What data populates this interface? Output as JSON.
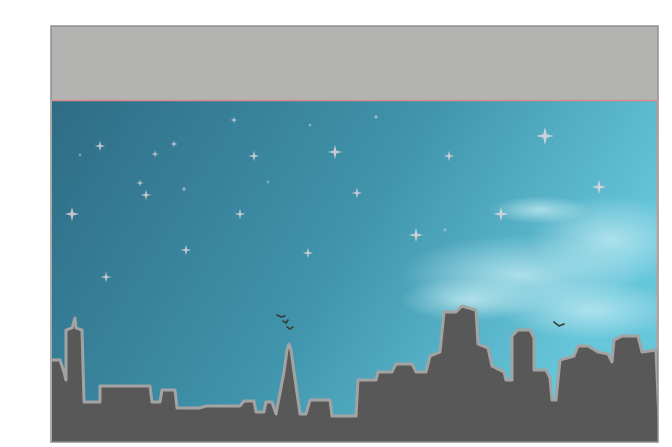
{
  "colors": {
    "page_bg": "#ffffff",
    "header_bar": "#b3b3b1",
    "frame_border": "#8e8e8e",
    "divider_line": "#d98b8b",
    "sky_top_left": "#2f6c85",
    "sky_mid": "#3f93ab",
    "sky_right": "#66c6da",
    "cloud": "#c6ecf3",
    "skyline_fill": "#585858",
    "skyline_outline": "#a3a3a3",
    "star": "#e9d9df",
    "bird": "#3a3a3a"
  },
  "scene": {
    "elements": [
      "header-bar",
      "night-sky",
      "stars",
      "clouds",
      "birds",
      "city-skyline"
    ]
  }
}
